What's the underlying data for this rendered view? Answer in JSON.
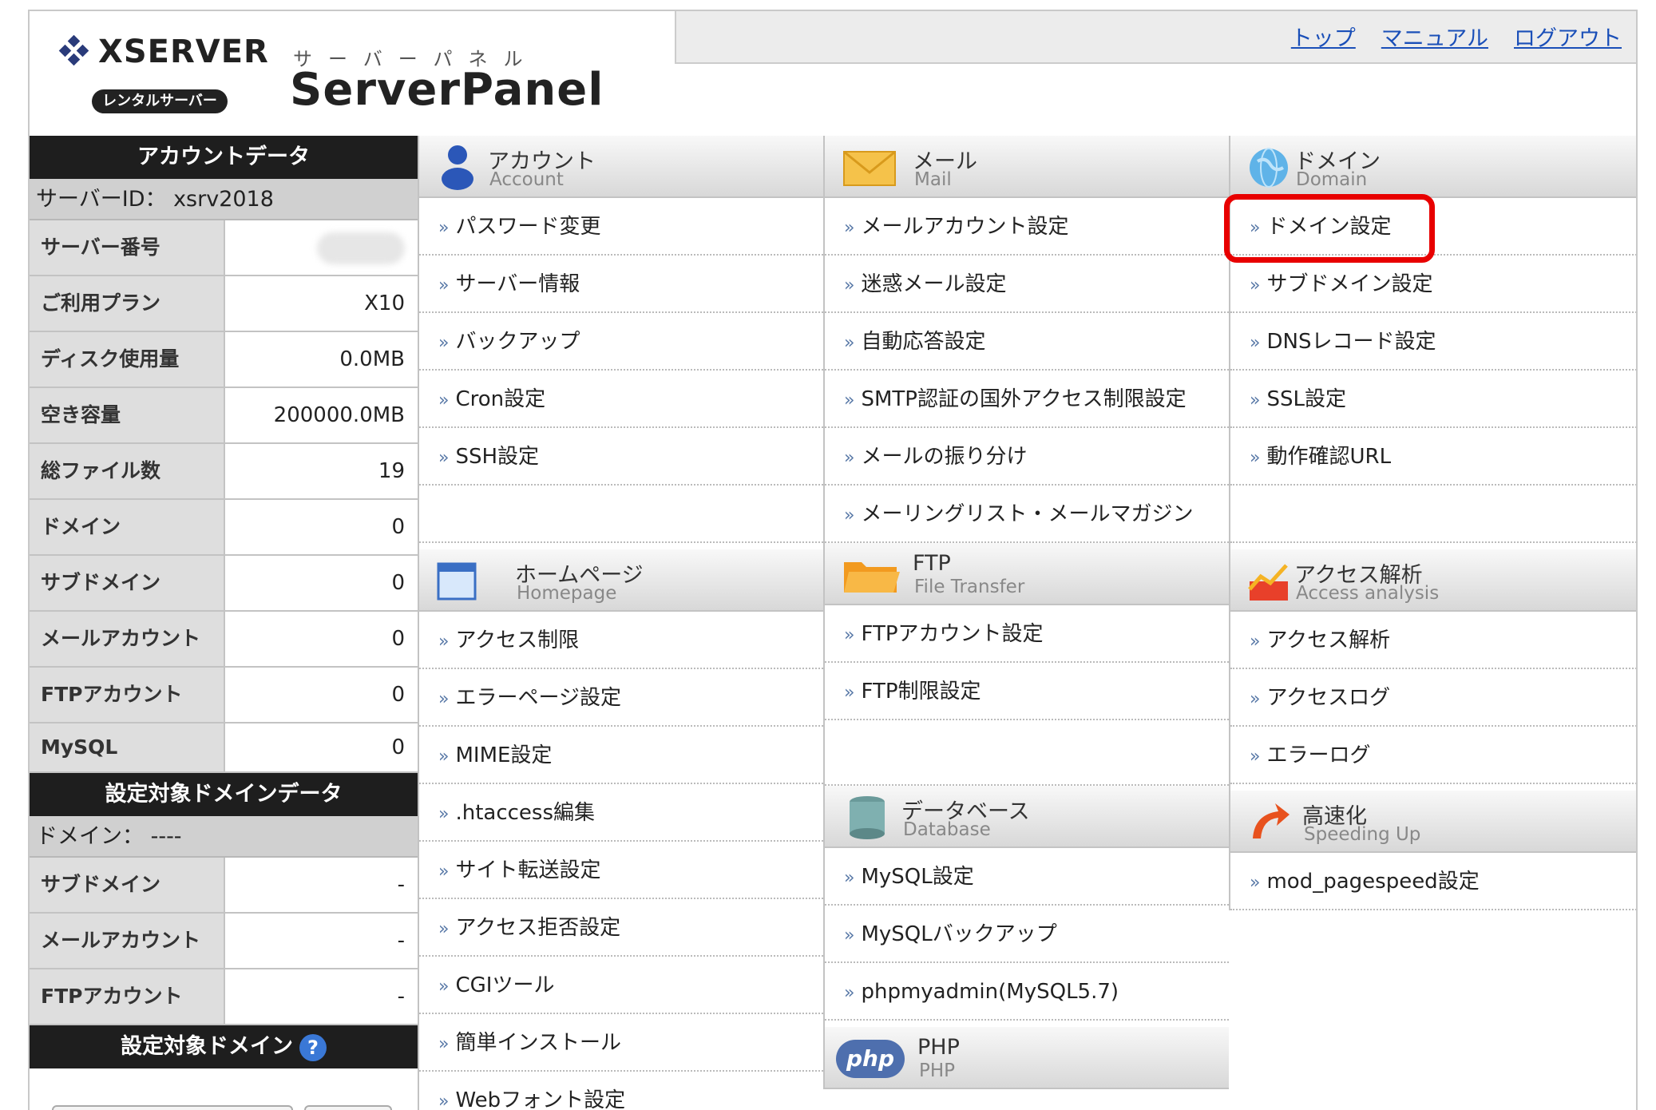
{
  "header": {
    "logo_text": "XSERVER",
    "logo_badge": "レンタルサーバー",
    "subtitle": "サーバーパネル",
    "brand": "ServerPanel",
    "nav": [
      "トップ",
      "マニュアル",
      "ログアウト"
    ]
  },
  "sidebar": {
    "account_title": "アカウントデータ",
    "server_id": "サーバーID： xsrv2018",
    "account_rows": [
      {
        "label": "サーバー番号",
        "value": ""
      },
      {
        "label": "ご利用プラン",
        "value": "X10"
      },
      {
        "label": "ディスク使用量",
        "value": "0.0MB"
      },
      {
        "label": "空き容量",
        "value": "200000.0MB"
      },
      {
        "label": "総ファイル数",
        "value": "19"
      },
      {
        "label": "ドメイン",
        "value": "0"
      },
      {
        "label": "サブドメイン",
        "value": "0"
      },
      {
        "label": "メールアカウント",
        "value": "0"
      },
      {
        "label": "FTPアカウント",
        "value": "0"
      },
      {
        "label": "MySQL",
        "value": "0"
      }
    ],
    "domain_title": "設定対象ドメインデータ",
    "domain_line": "ドメイン： ----",
    "domain_rows": [
      {
        "label": "サブドメイン",
        "value": "-"
      },
      {
        "label": "メールアカウント",
        "value": "-"
      },
      {
        "label": "FTPアカウント",
        "value": "-"
      }
    ],
    "target_title": "設定対象ドメイン",
    "help_icon": "?"
  },
  "sections": {
    "account": {
      "title": "アカウント",
      "sub": "Account",
      "items": [
        "パスワード変更",
        "サーバー情報",
        "バックアップ",
        "Cron設定",
        "SSH設定"
      ]
    },
    "homepage": {
      "title": "ホームページ",
      "sub": "Homepage",
      "items": [
        "アクセス制限",
        "エラーページ設定",
        "MIME設定",
        ".htaccess編集",
        "サイト転送設定",
        "アクセス拒否設定",
        "CGIツール",
        "簡単インストール",
        "Webフォント設定"
      ]
    },
    "mail": {
      "title": "メール",
      "sub": "Mail",
      "items": [
        "メールアカウント設定",
        "迷惑メール設定",
        "自動応答設定",
        "SMTP認証の国外アクセス制限設定",
        "メールの振り分け",
        "メーリングリスト・メールマガジン"
      ]
    },
    "ftp": {
      "title": "FTP",
      "sub": "File Transfer",
      "items": [
        "FTPアカウント設定",
        "FTP制限設定"
      ]
    },
    "database": {
      "title": "データベース",
      "sub": "Database",
      "items": [
        "MySQL設定",
        "MySQLバックアップ",
        "phpmyadmin(MySQL5.7)"
      ]
    },
    "php": {
      "title": "PHP",
      "sub": "PHP",
      "badge": "php"
    },
    "domain": {
      "title": "ドメイン",
      "sub": "Domain",
      "items": [
        "ドメイン設定",
        "サブドメイン設定",
        "DNSレコード設定",
        "SSL設定",
        "動作確認URL"
      ]
    },
    "access": {
      "title": "アクセス解析",
      "sub": "Access analysis",
      "items": [
        "アクセス解析",
        "アクセスログ",
        "エラーログ"
      ]
    },
    "speed": {
      "title": "高速化",
      "sub": "Speeding Up",
      "items": [
        "mod_pagespeed設定"
      ]
    }
  },
  "highlight_color": "#e80000"
}
